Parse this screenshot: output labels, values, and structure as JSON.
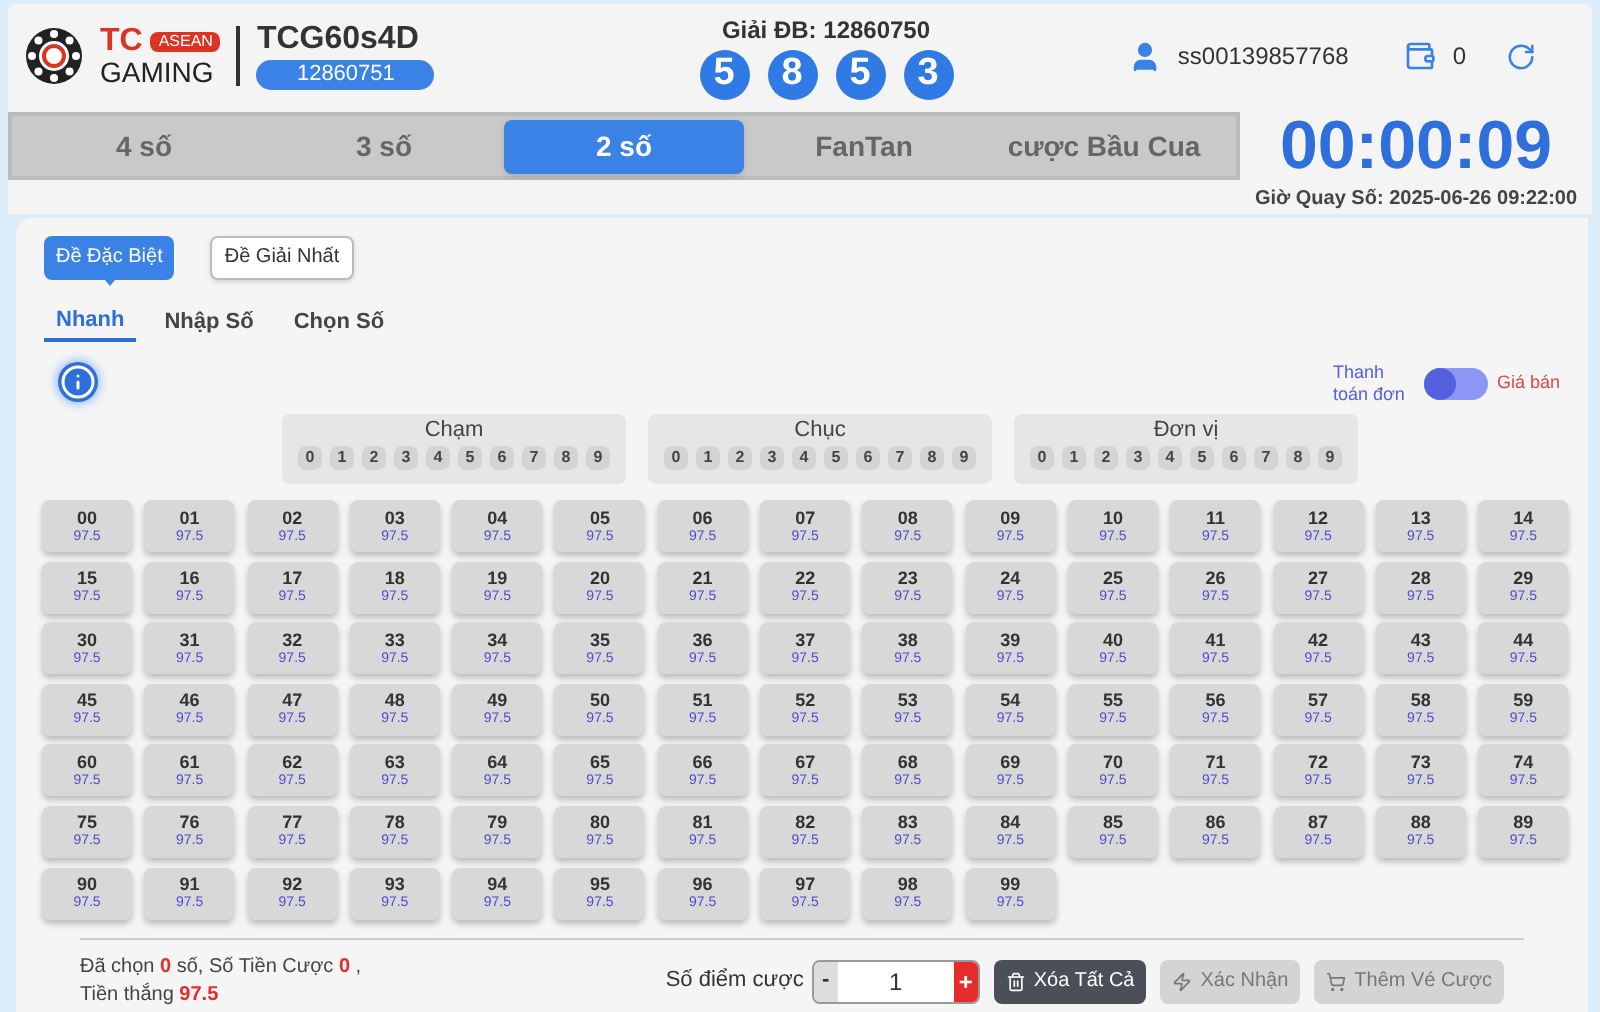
{
  "header": {
    "brand_top": "TC",
    "brand_badge": "ASEAN",
    "brand_bottom": "GAMING",
    "game": "TCG60s4D",
    "round": "12860751",
    "result_label": "Giải ĐB: 12860750",
    "balls": [
      "5",
      "8",
      "5",
      "3"
    ],
    "user": "ss00139857768",
    "balance": "0"
  },
  "tabs": [
    {
      "label": "4 số",
      "selected": false
    },
    {
      "label": "3 số",
      "selected": false
    },
    {
      "label": "2 số",
      "selected": true
    },
    {
      "label": "FanTan",
      "selected": false
    },
    {
      "label": "cược Bầu Cua",
      "selected": false
    }
  ],
  "timer": {
    "time": "00:00:09",
    "draw_time": "Giờ Quay Số: 2025-06-26 09:22:00"
  },
  "bet_types": [
    {
      "label": "Đề Đặc Biệt",
      "selected": true
    },
    {
      "label": "Đề Giải Nhất",
      "selected": false
    }
  ],
  "modes": [
    {
      "label": "Nhanh",
      "selected": true
    },
    {
      "label": "Nhập Số",
      "selected": false
    },
    {
      "label": "Chọn Số",
      "selected": false
    }
  ],
  "switch": {
    "left_label": "Thanh toán đơn",
    "right_label": "Giá bán",
    "on": false
  },
  "groups": [
    {
      "title": "Chạm",
      "digits": [
        "0",
        "1",
        "2",
        "3",
        "4",
        "5",
        "6",
        "7",
        "8",
        "9"
      ]
    },
    {
      "title": "Chục",
      "digits": [
        "0",
        "1",
        "2",
        "3",
        "4",
        "5",
        "6",
        "7",
        "8",
        "9"
      ]
    },
    {
      "title": "Đơn vị",
      "digits": [
        "0",
        "1",
        "2",
        "3",
        "4",
        "5",
        "6",
        "7",
        "8",
        "9"
      ]
    }
  ],
  "cells": [
    {
      "number": "00",
      "odds": "97.5"
    },
    {
      "number": "01",
      "odds": "97.5"
    },
    {
      "number": "02",
      "odds": "97.5"
    },
    {
      "number": "03",
      "odds": "97.5"
    },
    {
      "number": "04",
      "odds": "97.5"
    },
    {
      "number": "05",
      "odds": "97.5"
    },
    {
      "number": "06",
      "odds": "97.5"
    },
    {
      "number": "07",
      "odds": "97.5"
    },
    {
      "number": "08",
      "odds": "97.5"
    },
    {
      "number": "09",
      "odds": "97.5"
    },
    {
      "number": "10",
      "odds": "97.5"
    },
    {
      "number": "11",
      "odds": "97.5"
    },
    {
      "number": "12",
      "odds": "97.5"
    },
    {
      "number": "13",
      "odds": "97.5"
    },
    {
      "number": "14",
      "odds": "97.5"
    },
    {
      "number": "15",
      "odds": "97.5"
    },
    {
      "number": "16",
      "odds": "97.5"
    },
    {
      "number": "17",
      "odds": "97.5"
    },
    {
      "number": "18",
      "odds": "97.5"
    },
    {
      "number": "19",
      "odds": "97.5"
    },
    {
      "number": "20",
      "odds": "97.5"
    },
    {
      "number": "21",
      "odds": "97.5"
    },
    {
      "number": "22",
      "odds": "97.5"
    },
    {
      "number": "23",
      "odds": "97.5"
    },
    {
      "number": "24",
      "odds": "97.5"
    },
    {
      "number": "25",
      "odds": "97.5"
    },
    {
      "number": "26",
      "odds": "97.5"
    },
    {
      "number": "27",
      "odds": "97.5"
    },
    {
      "number": "28",
      "odds": "97.5"
    },
    {
      "number": "29",
      "odds": "97.5"
    },
    {
      "number": "30",
      "odds": "97.5"
    },
    {
      "number": "31",
      "odds": "97.5"
    },
    {
      "number": "32",
      "odds": "97.5"
    },
    {
      "number": "33",
      "odds": "97.5"
    },
    {
      "number": "34",
      "odds": "97.5"
    },
    {
      "number": "35",
      "odds": "97.5"
    },
    {
      "number": "36",
      "odds": "97.5"
    },
    {
      "number": "37",
      "odds": "97.5"
    },
    {
      "number": "38",
      "odds": "97.5"
    },
    {
      "number": "39",
      "odds": "97.5"
    },
    {
      "number": "40",
      "odds": "97.5"
    },
    {
      "number": "41",
      "odds": "97.5"
    },
    {
      "number": "42",
      "odds": "97.5"
    },
    {
      "number": "43",
      "odds": "97.5"
    },
    {
      "number": "44",
      "odds": "97.5"
    },
    {
      "number": "45",
      "odds": "97.5"
    },
    {
      "number": "46",
      "odds": "97.5"
    },
    {
      "number": "47",
      "odds": "97.5"
    },
    {
      "number": "48",
      "odds": "97.5"
    },
    {
      "number": "49",
      "odds": "97.5"
    },
    {
      "number": "50",
      "odds": "97.5"
    },
    {
      "number": "51",
      "odds": "97.5"
    },
    {
      "number": "52",
      "odds": "97.5"
    },
    {
      "number": "53",
      "odds": "97.5"
    },
    {
      "number": "54",
      "odds": "97.5"
    },
    {
      "number": "55",
      "odds": "97.5"
    },
    {
      "number": "56",
      "odds": "97.5"
    },
    {
      "number": "57",
      "odds": "97.5"
    },
    {
      "number": "58",
      "odds": "97.5"
    },
    {
      "number": "59",
      "odds": "97.5"
    },
    {
      "number": "60",
      "odds": "97.5"
    },
    {
      "number": "61",
      "odds": "97.5"
    },
    {
      "number": "62",
      "odds": "97.5"
    },
    {
      "number": "63",
      "odds": "97.5"
    },
    {
      "number": "64",
      "odds": "97.5"
    },
    {
      "number": "65",
      "odds": "97.5"
    },
    {
      "number": "66",
      "odds": "97.5"
    },
    {
      "number": "67",
      "odds": "97.5"
    },
    {
      "number": "68",
      "odds": "97.5"
    },
    {
      "number": "69",
      "odds": "97.5"
    },
    {
      "number": "70",
      "odds": "97.5"
    },
    {
      "number": "71",
      "odds": "97.5"
    },
    {
      "number": "72",
      "odds": "97.5"
    },
    {
      "number": "73",
      "odds": "97.5"
    },
    {
      "number": "74",
      "odds": "97.5"
    },
    {
      "number": "75",
      "odds": "97.5"
    },
    {
      "number": "76",
      "odds": "97.5"
    },
    {
      "number": "77",
      "odds": "97.5"
    },
    {
      "number": "78",
      "odds": "97.5"
    },
    {
      "number": "79",
      "odds": "97.5"
    },
    {
      "number": "80",
      "odds": "97.5"
    },
    {
      "number": "81",
      "odds": "97.5"
    },
    {
      "number": "82",
      "odds": "97.5"
    },
    {
      "number": "83",
      "odds": "97.5"
    },
    {
      "number": "84",
      "odds": "97.5"
    },
    {
      "number": "85",
      "odds": "97.5"
    },
    {
      "number": "86",
      "odds": "97.5"
    },
    {
      "number": "87",
      "odds": "97.5"
    },
    {
      "number": "88",
      "odds": "97.5"
    },
    {
      "number": "89",
      "odds": "97.5"
    },
    {
      "number": "90",
      "odds": "97.5"
    },
    {
      "number": "91",
      "odds": "97.5"
    },
    {
      "number": "92",
      "odds": "97.5"
    },
    {
      "number": "93",
      "odds": "97.5"
    },
    {
      "number": "94",
      "odds": "97.5"
    },
    {
      "number": "95",
      "odds": "97.5"
    },
    {
      "number": "96",
      "odds": "97.5"
    },
    {
      "number": "97",
      "odds": "97.5"
    },
    {
      "number": "98",
      "odds": "97.5"
    },
    {
      "number": "99",
      "odds": "97.5"
    }
  ],
  "footer": {
    "summary": "Đã chọn **0** số,  Số Tiền Cược **0** ,",
    "win": "Tiền thắng **97.5**",
    "points_label": "Số điểm cược",
    "minus": "-",
    "amount": "1",
    "plus": "+",
    "actions": [
      {
        "label": "Xóa Tất Cả",
        "kind": "clear",
        "disabled": false
      },
      {
        "label": "Xác Nhận",
        "kind": "confirm",
        "disabled": true
      },
      {
        "label": "Thêm Vé Cược",
        "kind": "cart",
        "disabled": true
      }
    ]
  }
}
